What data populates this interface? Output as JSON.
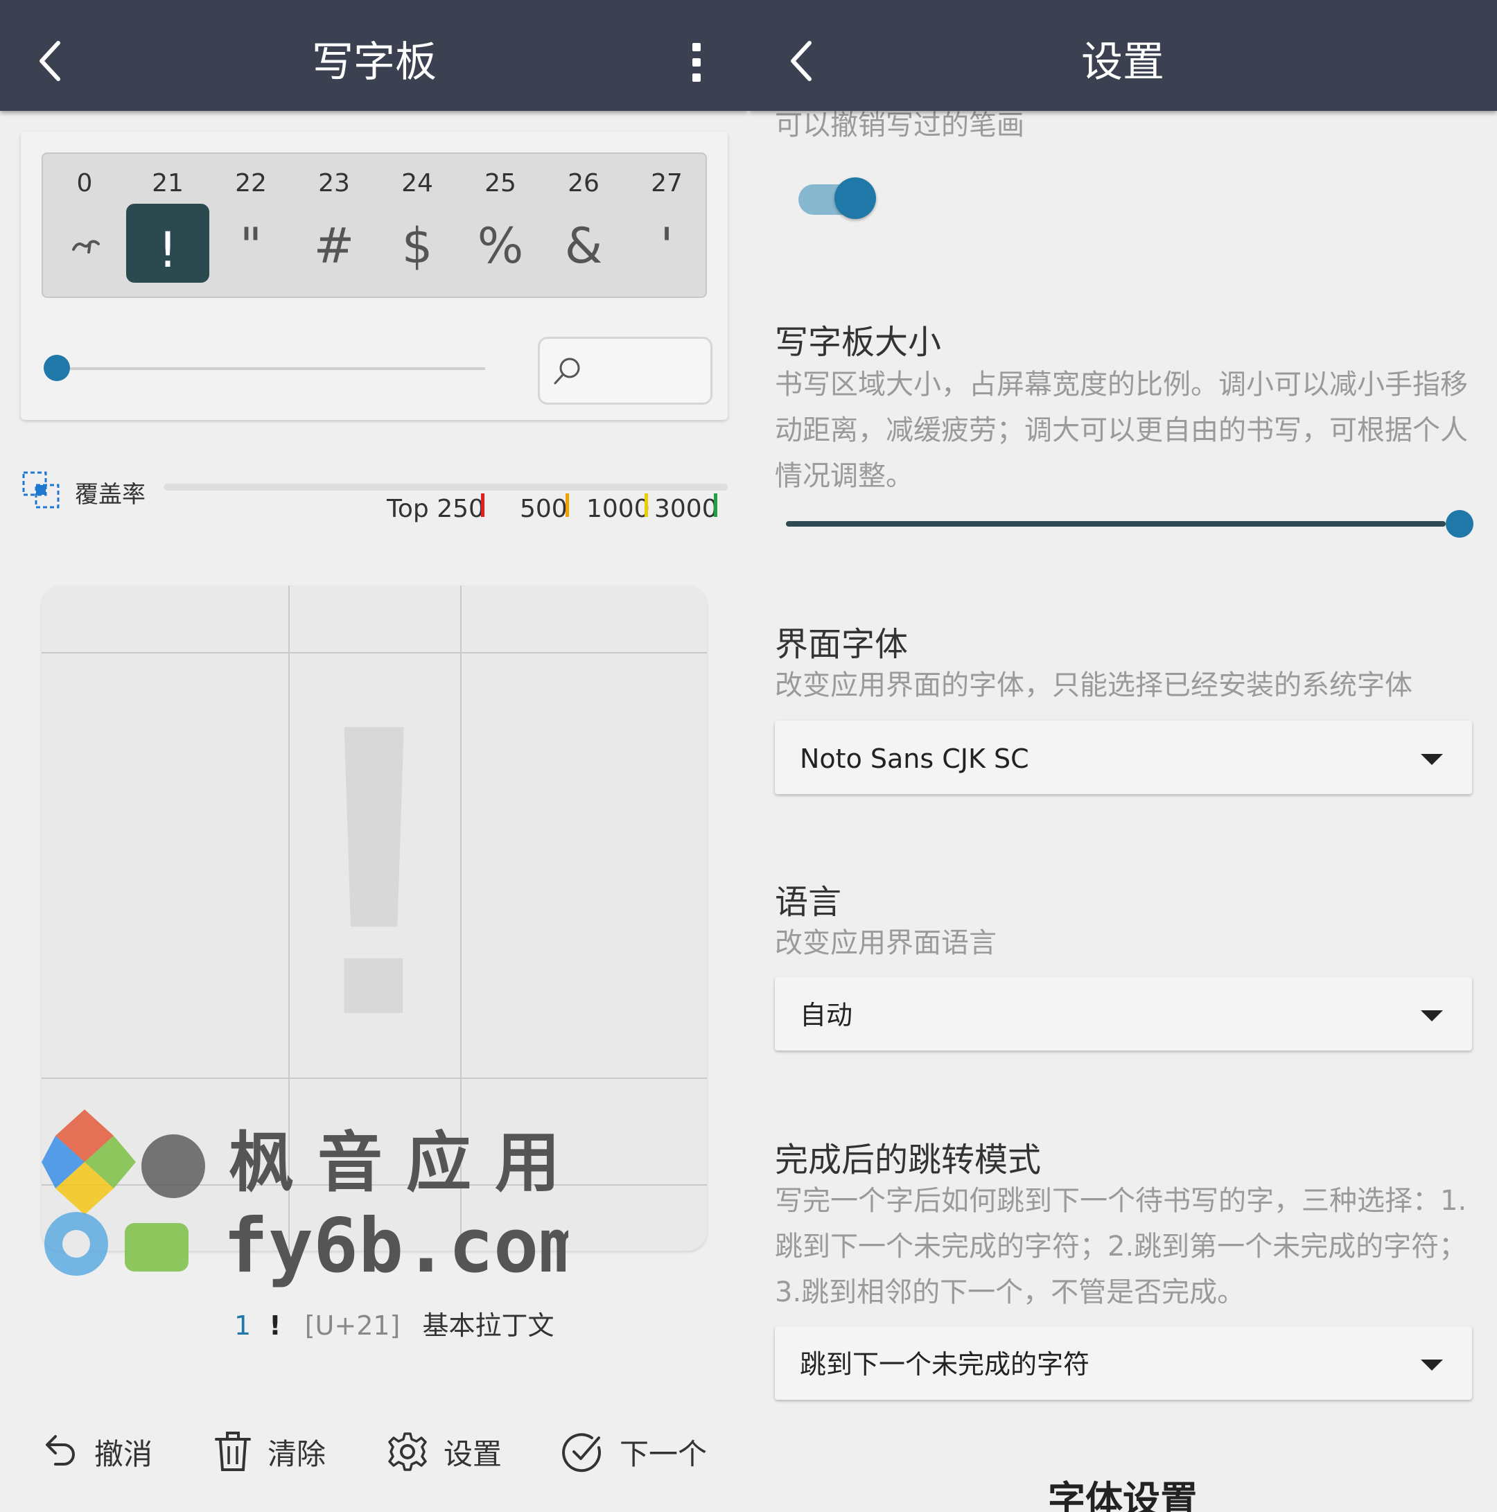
{
  "left": {
    "title": "写字板",
    "strip": [
      {
        "num": "0",
        "glyph": "~",
        "selected": false
      },
      {
        "num": "21",
        "glyph": "!",
        "selected": true
      },
      {
        "num": "22",
        "glyph": "\"",
        "selected": false
      },
      {
        "num": "23",
        "glyph": "#",
        "selected": false
      },
      {
        "num": "24",
        "glyph": "$",
        "selected": false
      },
      {
        "num": "25",
        "glyph": "%",
        "selected": false
      },
      {
        "num": "26",
        "glyph": "&",
        "selected": false
      },
      {
        "num": "27",
        "glyph": "'",
        "selected": false
      }
    ],
    "coverage": {
      "label": "覆盖率",
      "marks": [
        "Top 250",
        "500",
        "1000",
        "3000"
      ],
      "mark_colors": [
        "#e02020",
        "#f0a000",
        "#e8d000",
        "#20a040"
      ]
    },
    "pad_glyph": "!",
    "char_info": {
      "index": "1",
      "char": "!",
      "codepoint": "[U+21]",
      "block": "基本拉丁文"
    },
    "bottom": {
      "undo": "撤消",
      "clear": "清除",
      "settings": "设置",
      "next": "下一个"
    }
  },
  "right": {
    "title": "设置",
    "top_desc": "可以撤销写过的笔画",
    "pad_size": {
      "title": "写字板大小",
      "desc": "书写区域大小，占屏幕宽度的比例。调小可以减小手指移动距离，减缓疲劳；调大可以更自由的书写，可根据个人情况调整。",
      "value": 1.0
    },
    "ui_font": {
      "title": "界面字体",
      "desc": "改变应用界面的字体，只能选择已经安装的系统字体",
      "selected": "Noto Sans CJK SC"
    },
    "language": {
      "title": "语言",
      "desc": "改变应用界面语言",
      "selected": "自动"
    },
    "jump_mode": {
      "title": "完成后的跳转模式",
      "desc": "写完一个字后如何跳到下一个待书写的字，三种选择：1.跳到下一个未完成的字符；2.跳到第一个未完成的字符；3.跳到相邻的下一个，不管是否完成。",
      "selected": "跳到下一个未完成的字符"
    },
    "section_font": "字体设置"
  },
  "watermark": {
    "line1": "枫音应用",
    "line2": "fy6b.com"
  },
  "colors": {
    "appbar": "#3b4150",
    "accent": "#1f78a8",
    "selected_cell": "#2a4a50"
  }
}
